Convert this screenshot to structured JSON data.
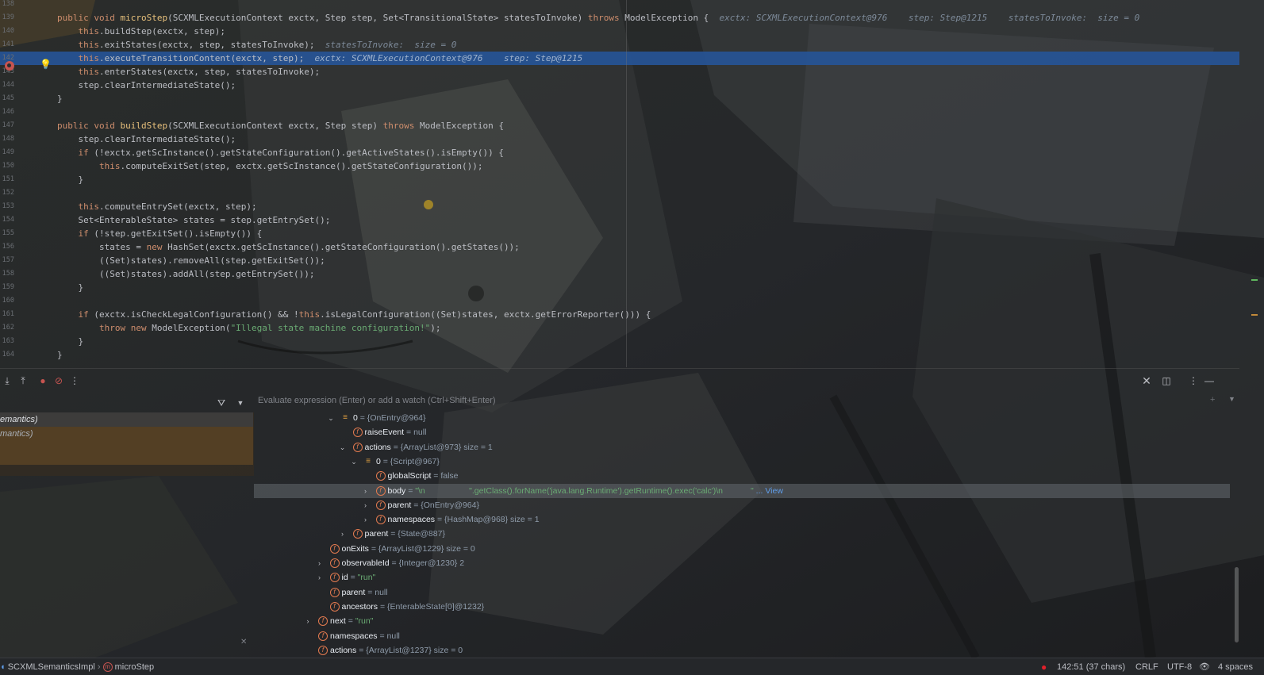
{
  "editor": {
    "lines": [
      {
        "num": "138",
        "segs": []
      },
      {
        "num": "139",
        "segs": [
          [
            "kw",
            "public void "
          ],
          [
            "fn",
            "microStep"
          ],
          [
            "",
            "(SCXMLExecutionContext exctx, Step step, Set<TransitionalState> statesToInvoke) "
          ],
          [
            "kw",
            "throws "
          ],
          [
            "",
            "ModelException {  "
          ],
          [
            "hint",
            "exctx: SCXMLExecutionContext@976    step: Step@1215    statesToInvoke:  size = 0"
          ]
        ]
      },
      {
        "num": "140",
        "segs": [
          [
            "",
            "    "
          ],
          [
            "kw",
            "this"
          ],
          [
            "",
            ".buildStep(exctx, step);"
          ]
        ]
      },
      {
        "num": "141",
        "segs": [
          [
            "",
            "    "
          ],
          [
            "kw",
            "this"
          ],
          [
            "",
            ".exitStates(exctx, step, statesToInvoke);  "
          ],
          [
            "hint",
            "statesToInvoke:  size = 0"
          ]
        ]
      },
      {
        "num": "142",
        "segs": [
          [
            "",
            "    "
          ],
          [
            "kw",
            "this"
          ],
          [
            "",
            ".executeTransitionContent(exctx, step);  "
          ],
          [
            "hint-w",
            "exctx: SCXMLExecutionContext@976    step: Step@1215"
          ]
        ],
        "highlight": true
      },
      {
        "num": "143",
        "segs": [
          [
            "",
            "    "
          ],
          [
            "kw",
            "this"
          ],
          [
            "",
            ".enterStates(exctx, step, statesToInvoke);"
          ]
        ]
      },
      {
        "num": "144",
        "segs": [
          [
            "",
            "    step.clearIntermediateState();"
          ]
        ]
      },
      {
        "num": "145",
        "segs": [
          [
            "",
            "}"
          ]
        ]
      },
      {
        "num": "146",
        "segs": []
      },
      {
        "num": "147",
        "segs": [
          [
            "kw",
            "public void "
          ],
          [
            "fn",
            "buildStep"
          ],
          [
            "",
            "(SCXMLExecutionContext exctx, Step step) "
          ],
          [
            "kw",
            "throws "
          ],
          [
            "",
            "ModelException {"
          ]
        ]
      },
      {
        "num": "148",
        "segs": [
          [
            "",
            "    step.clearIntermediateState();"
          ]
        ]
      },
      {
        "num": "149",
        "segs": [
          [
            "",
            "    "
          ],
          [
            "kw",
            "if "
          ],
          [
            "",
            "(!exctx.getScInstance().getStateConfiguration().getActiveStates().isEmpty()) {"
          ]
        ]
      },
      {
        "num": "150",
        "segs": [
          [
            "",
            "        "
          ],
          [
            "kw",
            "this"
          ],
          [
            "",
            ".computeExitSet(step, exctx.getScInstance().getStateConfiguration());"
          ]
        ]
      },
      {
        "num": "151",
        "segs": [
          [
            "",
            "    }"
          ]
        ]
      },
      {
        "num": "152",
        "segs": []
      },
      {
        "num": "153",
        "segs": [
          [
            "",
            "    "
          ],
          [
            "kw",
            "this"
          ],
          [
            "",
            ".computeEntrySet(exctx, step);"
          ]
        ]
      },
      {
        "num": "154",
        "segs": [
          [
            "",
            "    Set<EnterableState> states = step.getEntrySet();"
          ]
        ]
      },
      {
        "num": "155",
        "segs": [
          [
            "",
            "    "
          ],
          [
            "kw",
            "if "
          ],
          [
            "",
            "(!step.getExitSet().isEmpty()) {"
          ]
        ]
      },
      {
        "num": "156",
        "segs": [
          [
            "",
            "        states = "
          ],
          [
            "kw",
            "new "
          ],
          [
            "",
            "HashSet(exctx.getScInstance().getStateConfiguration().getStates());"
          ]
        ]
      },
      {
        "num": "157",
        "segs": [
          [
            "",
            "        ((Set)states).removeAll(step.getExitSet());"
          ]
        ]
      },
      {
        "num": "158",
        "segs": [
          [
            "",
            "        ((Set)states).addAll(step.getEntrySet());"
          ]
        ]
      },
      {
        "num": "159",
        "segs": [
          [
            "",
            "    }"
          ]
        ]
      },
      {
        "num": "160",
        "segs": []
      },
      {
        "num": "161",
        "segs": [
          [
            "",
            "    "
          ],
          [
            "kw",
            "if "
          ],
          [
            "",
            "(exctx.isCheckLegalConfiguration() && !"
          ],
          [
            "kw",
            "this"
          ],
          [
            "",
            ".isLegalConfiguration((Set)states, exctx.getErrorReporter())) {"
          ]
        ]
      },
      {
        "num": "162",
        "segs": [
          [
            "",
            "        "
          ],
          [
            "kw",
            "throw new "
          ],
          [
            "",
            "ModelException("
          ],
          [
            "str",
            "\"Illegal state machine configuration!\""
          ],
          [
            "",
            ");"
          ]
        ]
      },
      {
        "num": "163",
        "segs": [
          [
            "",
            "    }"
          ]
        ]
      },
      {
        "num": "164",
        "segs": [
          [
            "",
            "}"
          ]
        ]
      }
    ]
  },
  "frames": [
    {
      "label": "emantics)"
    },
    {
      "label": "mantics)"
    }
  ],
  "variables": {
    "eval_placeholder": "Evaluate expression (Enter) or add a watch (Ctrl+Shift+Enter)",
    "rows": [
      {
        "indent": 0,
        "arrow": "down",
        "icon": "array",
        "name": "0",
        "value": " = {OnEntry@964}"
      },
      {
        "indent": 1,
        "arrow": "",
        "icon": "field",
        "name": "raiseEvent",
        "value": " = null"
      },
      {
        "indent": 1,
        "arrow": "down",
        "icon": "field",
        "name": "actions",
        "value": " = {ArrayList@973}  size = 1"
      },
      {
        "indent": 2,
        "arrow": "down",
        "icon": "array",
        "name": "0",
        "value": " = {Script@967}"
      },
      {
        "indent": 3,
        "arrow": "",
        "icon": "field",
        "name": "globalScript",
        "value": " = false"
      },
      {
        "indent": 3,
        "arrow": "right",
        "icon": "field",
        "name": "body",
        "value": " = ",
        "str": "\"\\n                   \".getClass().forName('java.lang.Runtime').getRuntime().exec('calc')\\n            \"",
        "link": "... View",
        "selected": true
      },
      {
        "indent": 3,
        "arrow": "right",
        "icon": "field",
        "name": "parent",
        "value": " = {OnEntry@964}"
      },
      {
        "indent": 3,
        "arrow": "right",
        "icon": "field",
        "name": "namespaces",
        "value": " = {HashMap@968}  size = 1"
      },
      {
        "indent": 1,
        "arrow": "right",
        "icon": "field",
        "name": "parent",
        "value": " = {State@887}"
      },
      {
        "indent": -1,
        "arrow": "",
        "icon": "field",
        "name": "onExits",
        "value": " = {ArrayList@1229}  size = 0"
      },
      {
        "indent": -1,
        "arrow": "right",
        "icon": "field",
        "name": "observableId",
        "value": " = {Integer@1230} 2"
      },
      {
        "indent": -1,
        "arrow": "right",
        "icon": "field",
        "name": "id",
        "value": " = ",
        "str": "\"run\""
      },
      {
        "indent": -1,
        "arrow": "",
        "icon": "field",
        "name": "parent",
        "value": " = null"
      },
      {
        "indent": -1,
        "arrow": "",
        "icon": "field",
        "name": "ancestors",
        "value": " = {EnterableState[0]@1232}"
      },
      {
        "indent": -2,
        "arrow": "right",
        "icon": "field",
        "name": "next",
        "value": " = ",
        "str": "\"run\""
      },
      {
        "indent": -2,
        "arrow": "",
        "icon": "field",
        "name": "namespaces",
        "value": " = null"
      },
      {
        "indent": -2,
        "arrow": "",
        "icon": "field",
        "name": "actions",
        "value": " = {ArrayList@1237}  size = 0"
      }
    ]
  },
  "breadcrumb": {
    "class_name": "SCXMLSemanticsImpl",
    "method_badge": "m",
    "method_name": "microStep"
  },
  "status": {
    "position": "142:51 (37 chars)",
    "line_sep": "CRLF",
    "encoding": "UTF-8",
    "indent": "4 spaces"
  },
  "colors": {
    "highlight": "#2654a0",
    "keyword": "#cf8e6d",
    "function": "#e8c17c",
    "string": "#6aab73",
    "breakpoint": "#c75450"
  }
}
